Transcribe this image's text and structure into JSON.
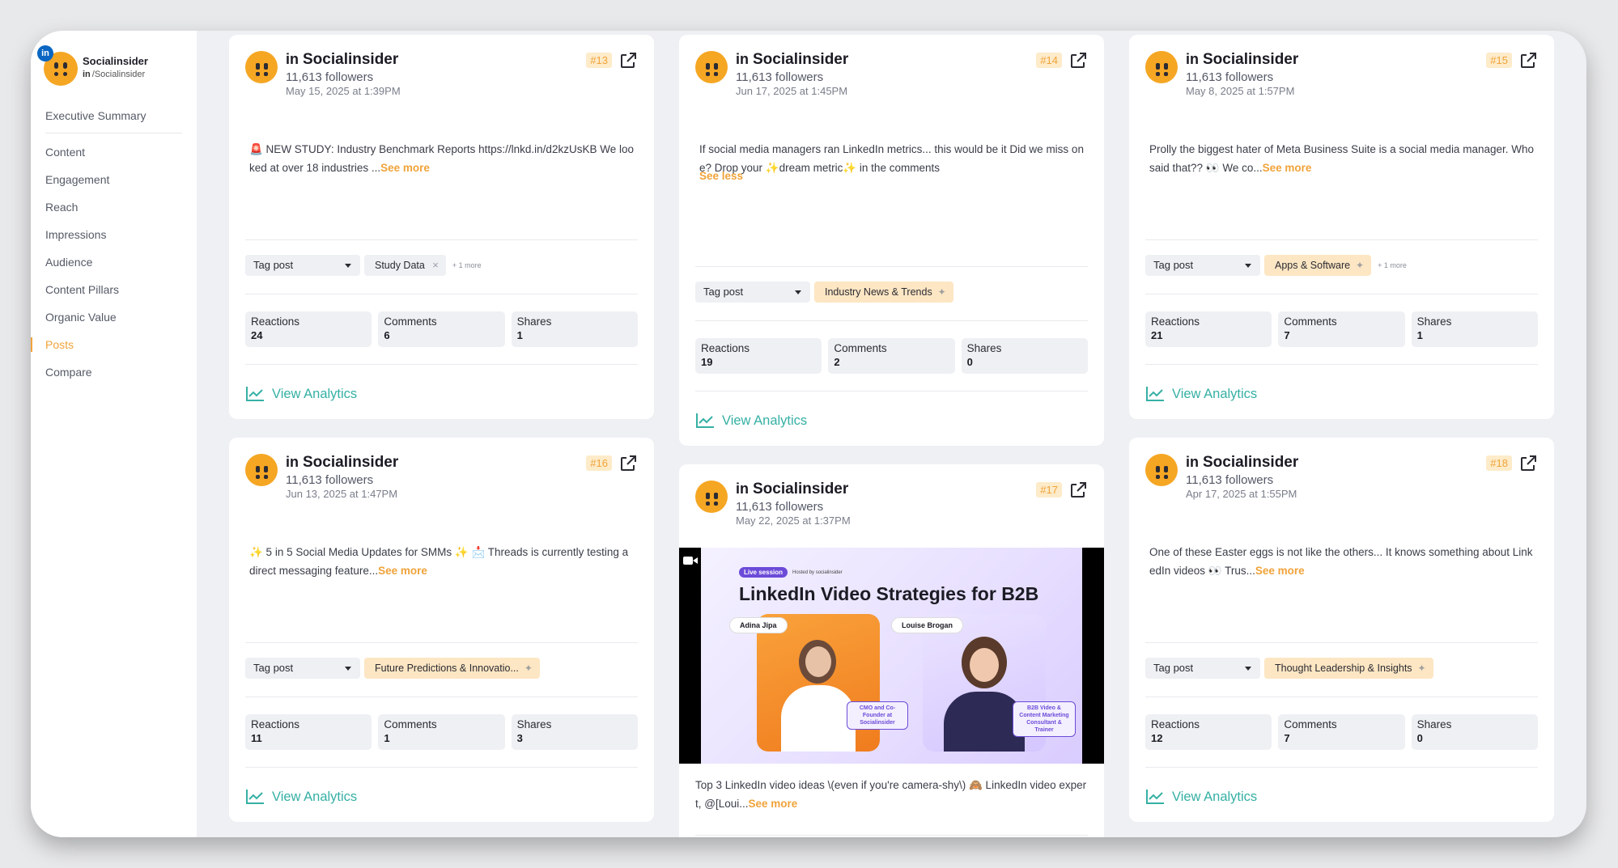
{
  "brand": {
    "name": "Socialinsider",
    "network_badge": "in",
    "handle_prefix": "in",
    "handle": "/Socialinsider"
  },
  "sidebar": {
    "items": [
      {
        "label": "Executive Summary"
      },
      {
        "label": "Content"
      },
      {
        "label": "Engagement"
      },
      {
        "label": "Reach"
      },
      {
        "label": "Impressions"
      },
      {
        "label": "Audience"
      },
      {
        "label": "Content Pillars"
      },
      {
        "label": "Organic Value"
      },
      {
        "label": "Posts",
        "active": true
      },
      {
        "label": "Compare"
      }
    ]
  },
  "common": {
    "in_prefix": "in",
    "tag_post": "Tag post",
    "reactions_label": "Reactions",
    "comments_label": "Comments",
    "shares_label": "Shares",
    "view_analytics": "View Analytics"
  },
  "posts": [
    {
      "author": "Socialinsider",
      "followers": "11,613 followers",
      "date": "May 15, 2025 at 1:39PM",
      "number": "#13",
      "text": "🚨 NEW STUDY: Industry Benchmark Reports https://lnkd.in/d2kzUsKB We looked at over 18 industries ...",
      "toggle": "See more",
      "tag": "Study Data",
      "tag_style": "grey",
      "extra": "+ 1 more",
      "reactions": "24",
      "comments": "6",
      "shares": "1"
    },
    {
      "author": "Socialinsider",
      "followers": "11,613 followers",
      "date": "Jun 17, 2025 at 1:45PM",
      "number": "#14",
      "text": "If social media managers ran LinkedIn metrics... this would be it Did we miss one? Drop your ✨dream metric✨ in the comments",
      "toggle": "See less",
      "tag": "Industry News & Trends",
      "tag_style": "orange",
      "extra": "",
      "reactions": "19",
      "comments": "2",
      "shares": "0"
    },
    {
      "author": "Socialinsider",
      "followers": "11,613 followers",
      "date": "May 8, 2025 at 1:57PM",
      "number": "#15",
      "text": "Prolly the biggest hater of Meta Business Suite is a social media manager. Who said that?? 👀 We co...",
      "toggle": "See more",
      "tag": "Apps & Software",
      "tag_style": "orange",
      "extra": "+ 1 more",
      "reactions": "21",
      "comments": "7",
      "shares": "1"
    },
    {
      "author": "Socialinsider",
      "followers": "11,613 followers",
      "date": "Jun 13, 2025 at 1:47PM",
      "number": "#16",
      "text": "✨ 5 in 5 Social Media Updates for SMMs ✨ 📩 Threads is currently testing a direct messaging feature...",
      "toggle": "See more",
      "tag": "Future Predictions & Innovatio...",
      "tag_style": "orange",
      "extra": "",
      "reactions": "11",
      "comments": "1",
      "shares": "3"
    },
    {
      "author": "Socialinsider",
      "followers": "11,613 followers",
      "date": "May 22, 2025 at 1:37PM",
      "number": "#17",
      "text": "Top 3 LinkedIn video ideas \\(even if you're camera-shy\\) 🙈 LinkedIn video expert, @[Loui...",
      "toggle": "See more",
      "video": {
        "badge": "Live session",
        "hosted": "Hosted by socialinsider",
        "title": "LinkedIn Video Strategies for B2B",
        "speaker1": "Adina Jipa",
        "role1": "CMO and Co-Founder at Socialinsider",
        "speaker2": "Louise Brogan",
        "role2": "B2B Video & Content Marketing Consultant & Trainer"
      }
    },
    {
      "author": "Socialinsider",
      "followers": "11,613 followers",
      "date": "Apr 17, 2025 at 1:55PM",
      "number": "#18",
      "text": "One of these Easter eggs is not like the others... It knows something about LinkedIn videos 👀 Trus...",
      "toggle": "See more",
      "tag": "Thought Leadership & Insights",
      "tag_style": "orange",
      "extra": "",
      "reactions": "12",
      "comments": "7",
      "shares": "0"
    }
  ],
  "colors": {
    "accent": "#f0a33a",
    "teal": "#35b0a4",
    "brand_orange": "#f5a623",
    "linkedin_blue": "#0a66c2"
  }
}
